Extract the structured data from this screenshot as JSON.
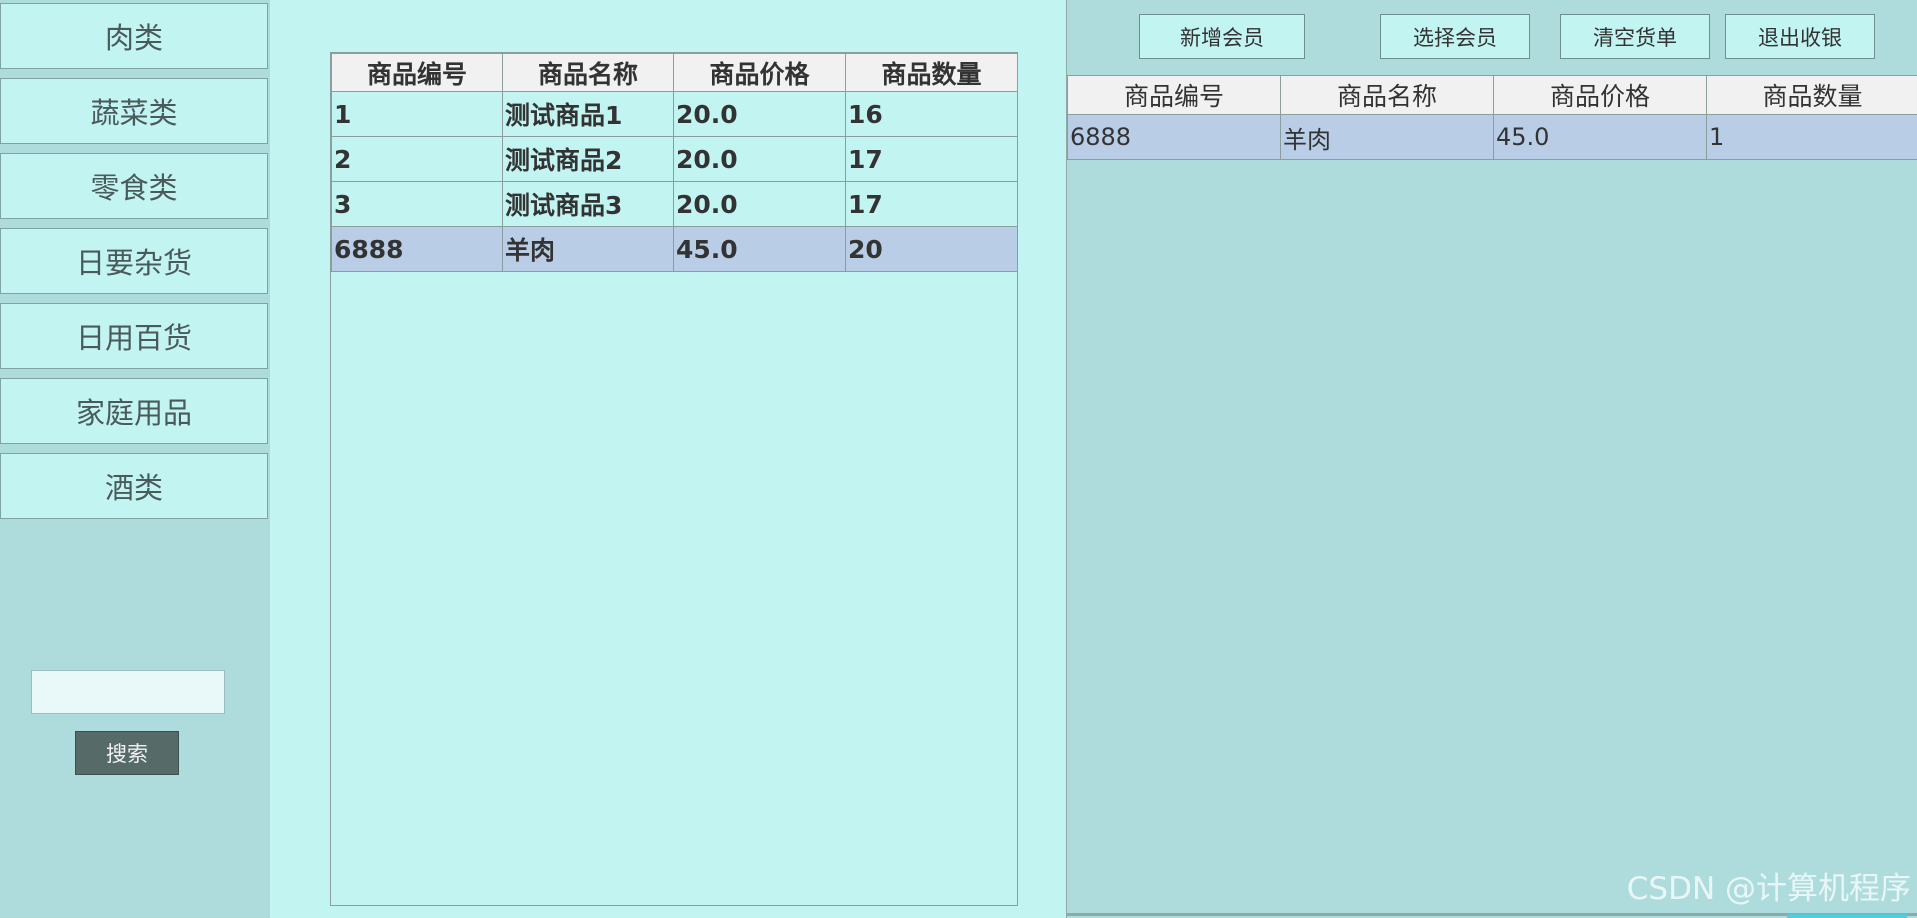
{
  "sidebar": {
    "categories": [
      "肉类",
      "蔬菜类",
      "零食类",
      "日要杂货",
      "日用百货",
      "家庭用品",
      "酒类"
    ],
    "search_value": "",
    "search_button": "搜索"
  },
  "products": {
    "columns": [
      "商品编号",
      "商品名称",
      "商品价格",
      "商品数量"
    ],
    "rows": [
      [
        "1",
        "测试商品1",
        "20.0",
        "16"
      ],
      [
        "2",
        "测试商品2",
        "20.0",
        "17"
      ],
      [
        "3",
        "测试商品3",
        "20.0",
        "17"
      ],
      [
        "6888",
        "羊肉",
        "45.0",
        "20"
      ]
    ]
  },
  "toolbar": {
    "add_member": "新增会员",
    "select_member": "选择会员",
    "clear_list": "清空货单",
    "exit_checkout": "退出收银"
  },
  "cart": {
    "columns": [
      "商品编号",
      "商品名称",
      "商品价格",
      "商品数量"
    ],
    "rows": [
      [
        "6888",
        "羊肉",
        "45.0",
        "1"
      ]
    ]
  },
  "watermark": "CSDN @计算机程序",
  "colors": {
    "panel": "#c2f4f2",
    "background": "#aedcdc",
    "selected_row": "#b9cde6",
    "search_button": "#566a68"
  }
}
